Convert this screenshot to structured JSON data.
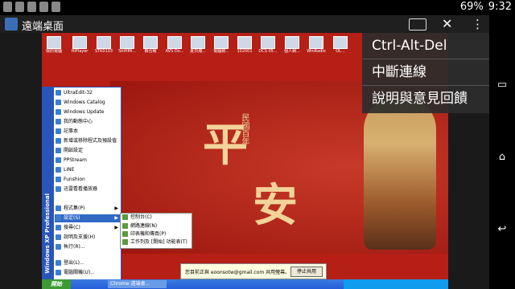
{
  "status_bar": {
    "battery": "69%",
    "time": "9:32"
  },
  "app_bar": {
    "title": "遠端桌面",
    "close_glyph": "✕",
    "more_glyph": "⋮"
  },
  "menu": {
    "items": [
      "Ctrl-Alt-Del",
      "中斷連線",
      "說明與意見回饋"
    ]
  },
  "desktop": {
    "wallpaper_chars": [
      "平",
      "安"
    ],
    "wallpaper_sub": "民國百年",
    "icons": [
      {
        "label": "我的電腦"
      },
      {
        "label": "HiPlayer"
      },
      {
        "label": "STK0103"
      },
      {
        "label": "ShiftMi..."
      },
      {
        "label": "聯合報"
      },
      {
        "label": "AVS Do..."
      },
      {
        "label": "夏日潮..."
      },
      {
        "label": "電腦網..."
      },
      {
        "label": "102001"
      },
      {
        "label": "DCS 05..."
      },
      {
        "label": "個人網..."
      },
      {
        "label": "WinRadio"
      },
      {
        "label": "OL..."
      }
    ],
    "start_menu": {
      "side_label": "Windows XP Professional",
      "items": [
        {
          "label": "UltraEdit-32"
        },
        {
          "label": "Windows Catalog"
        },
        {
          "label": "Windows Update"
        },
        {
          "label": "我的動態中心"
        },
        {
          "label": "記事本"
        },
        {
          "label": "新增或移除程式及預設值"
        },
        {
          "label": "開啟設定"
        },
        {
          "label": "PPStream"
        },
        {
          "label": "LINE"
        },
        {
          "label": "Funshion"
        },
        {
          "label": "迅雷看看播放器"
        },
        {
          "label": "程式集(P)"
        },
        {
          "label": "設定(S)"
        },
        {
          "label": "搜尋(C)"
        },
        {
          "label": "說明及支援(H)"
        },
        {
          "label": "執行(R)..."
        },
        {
          "label": "登出(L)..."
        },
        {
          "label": "電腦關機(U)..."
        }
      ],
      "highlighted": "設定(S)"
    },
    "submenu": {
      "items": [
        {
          "label": "控制台(C)"
        },
        {
          "label": "網路連線(N)"
        },
        {
          "label": "印表機和傳真(P)"
        },
        {
          "label": "工作列及 [開始] 功能表(T)"
        }
      ]
    },
    "balloon": {
      "message": "您目前正與 eoonsotw@gmail.com 共用螢幕。",
      "button": "停止共用"
    },
    "taskbar": {
      "start": "開始",
      "task": "Chrome 遠端桌..."
    }
  }
}
